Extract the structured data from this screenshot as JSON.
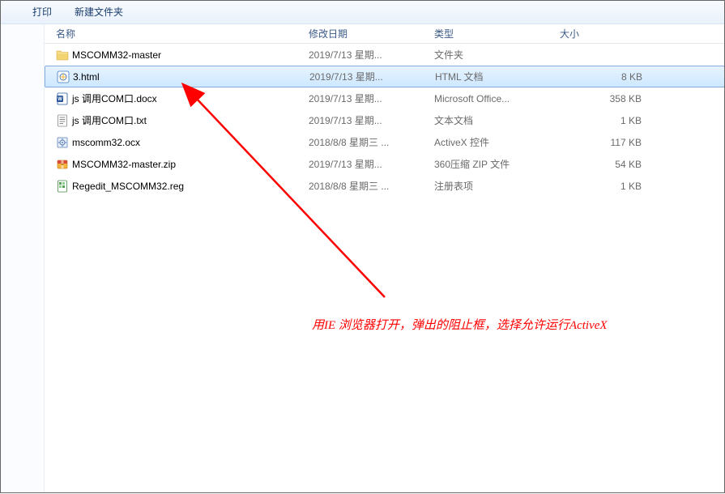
{
  "toolbar": {
    "print": "打印",
    "new_folder": "新建文件夹"
  },
  "columns": {
    "name": "名称",
    "date": "修改日期",
    "type": "类型",
    "size": "大小"
  },
  "files": [
    {
      "icon": "folder",
      "name": "MSCOMM32-master",
      "date": "2019/7/13 星期...",
      "type": "文件夹",
      "size": ""
    },
    {
      "icon": "html",
      "name": "3.html",
      "date": "2019/7/13 星期...",
      "type": "HTML 文档",
      "size": "8 KB",
      "selected": true
    },
    {
      "icon": "docx",
      "name": "js 调用COM口.docx",
      "date": "2019/7/13 星期...",
      "type": "Microsoft Office...",
      "size": "358 KB"
    },
    {
      "icon": "txt",
      "name": "js 调用COM口.txt",
      "date": "2019/7/13 星期...",
      "type": "文本文档",
      "size": "1 KB"
    },
    {
      "icon": "ocx",
      "name": "mscomm32.ocx",
      "date": "2018/8/8 星期三 ...",
      "type": "ActiveX 控件",
      "size": "117 KB"
    },
    {
      "icon": "zip",
      "name": "MSCOMM32-master.zip",
      "date": "2019/7/13 星期...",
      "type": "360压缩 ZIP 文件",
      "size": "54 KB"
    },
    {
      "icon": "reg",
      "name": "Regedit_MSCOMM32.reg",
      "date": "2018/8/8 星期三 ...",
      "type": "注册表项",
      "size": "1 KB"
    }
  ],
  "annotation": "用IE 浏览器打开，弹出的阻止框，选择允许运行ActiveX"
}
